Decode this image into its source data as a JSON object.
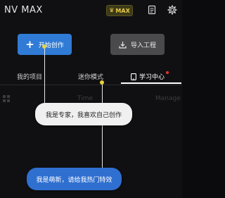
{
  "header": {
    "app_title": "NV MAX",
    "max_badge_label": "MAX",
    "icons": [
      "crown-icon",
      "document-icon",
      "settings-icon"
    ]
  },
  "actions": {
    "create_label": "开始创作",
    "import_label": "导入工程"
  },
  "tabs": [
    {
      "label": "我的项目"
    },
    {
      "label": "迷你模式"
    },
    {
      "label": "学习中心",
      "active": true,
      "has_dot": true
    }
  ],
  "list_header": {
    "time_label": "Time",
    "manage_label": "Manage"
  },
  "guides": {
    "expert_tip": "我是专家，我喜欢自己创作",
    "novice_tip": "我是萌新，请给我热门特效"
  },
  "colors": {
    "accent_blue": "#2f7bd6",
    "badge_gold": "#e7c94a",
    "dot_red": "#e8332a",
    "guide_dot": "#e8d23a"
  }
}
